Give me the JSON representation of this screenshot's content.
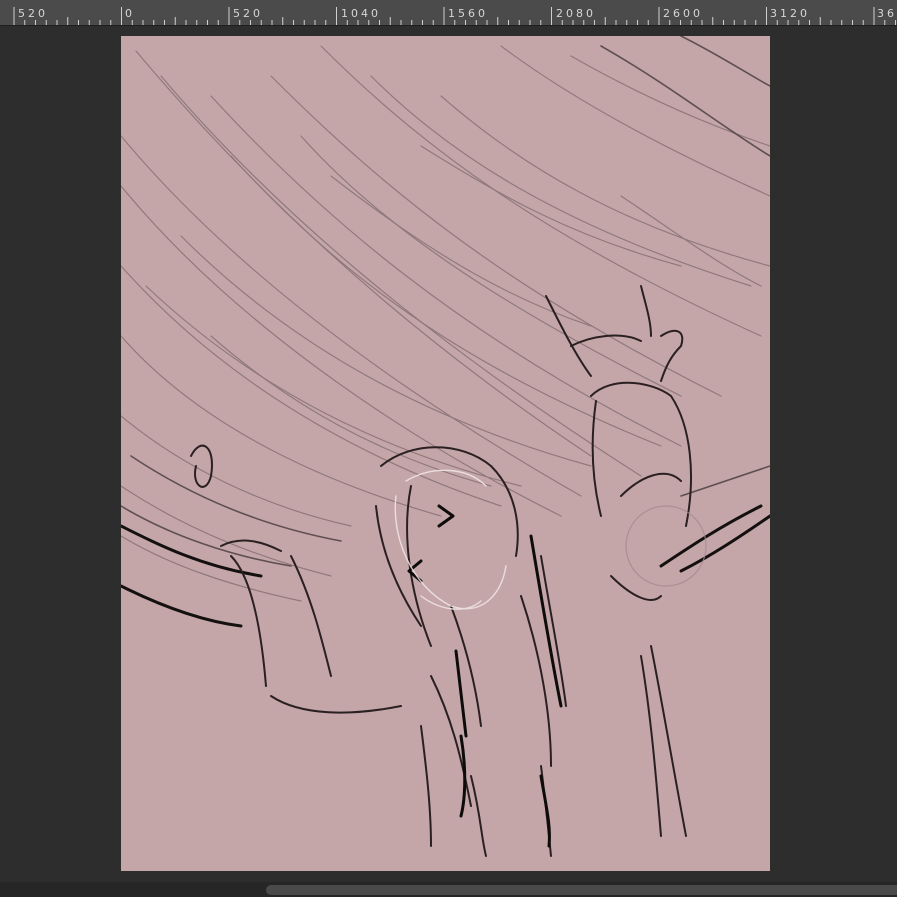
{
  "ruler": {
    "labels": [
      "520",
      "0",
      "520",
      "1040",
      "1560",
      "2080",
      "2600",
      "3120",
      "36"
    ]
  },
  "canvas": {
    "background_color": "#c4a6a8"
  },
  "scrollbar": {
    "orientation": "horizontal"
  }
}
